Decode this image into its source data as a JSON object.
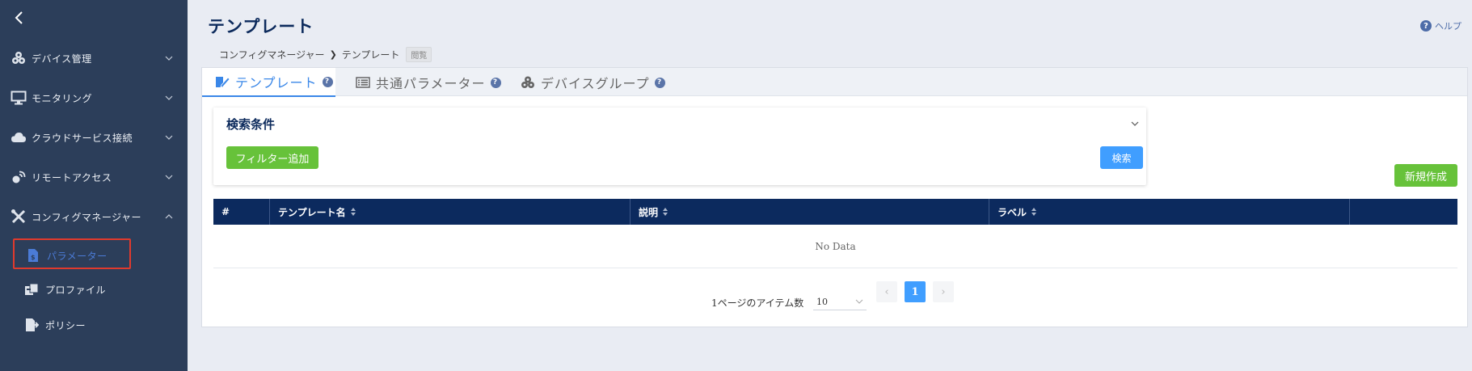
{
  "header": {
    "title": "テンプレート",
    "help_label": "ヘルプ",
    "help_icon_glyph": "?"
  },
  "breadcrumb": {
    "items": [
      "コンフィグマネージャー",
      "テンプレート"
    ],
    "separator": "❯",
    "badge": "閲覧"
  },
  "sidebar": {
    "items": [
      {
        "label": "デバイス管理",
        "icon": "devices-icon",
        "expanded": false
      },
      {
        "label": "モニタリング",
        "icon": "monitor-icon",
        "expanded": false
      },
      {
        "label": "クラウドサービス接続",
        "icon": "cloud-icon",
        "expanded": false
      },
      {
        "label": "リモートアクセス",
        "icon": "remote-access-icon",
        "expanded": false
      },
      {
        "label": "コンフィグマネージャー",
        "icon": "tools-icon",
        "expanded": true
      }
    ],
    "subitems": [
      {
        "label": "パラメーター",
        "icon": "parameter-icon",
        "active": true
      },
      {
        "label": "プロファイル",
        "icon": "profile-icon",
        "active": false
      },
      {
        "label": "ポリシー",
        "icon": "policy-icon",
        "active": false
      }
    ]
  },
  "tabs": [
    {
      "label": "テンプレート",
      "icon": "template-edit-icon",
      "active": true
    },
    {
      "label": "共通パラメーター",
      "icon": "list-icon",
      "active": false
    },
    {
      "label": "デバイスグループ",
      "icon": "device-group-icon",
      "active": false
    }
  ],
  "tab_help_glyph": "?",
  "search": {
    "title": "検索条件",
    "filter_button": "フィルター追加",
    "search_button": "検索"
  },
  "new_button": "新規作成",
  "table": {
    "columns": [
      "#",
      "テンプレート名",
      "説明",
      "ラベル",
      ""
    ],
    "empty_text": "No Data"
  },
  "pagination": {
    "items_per_page_label": "1ページのアイテム数",
    "page_size": "10",
    "prev": "‹",
    "current_page": "1",
    "next": "›"
  },
  "colors": {
    "sidebar_bg": "#2c3e5a",
    "header_dark": "#0c2a5e",
    "accent_blue": "#409eff",
    "accent_green": "#67c23a",
    "active_tab": "#3a87e8",
    "highlight_red": "#e03a2d"
  }
}
